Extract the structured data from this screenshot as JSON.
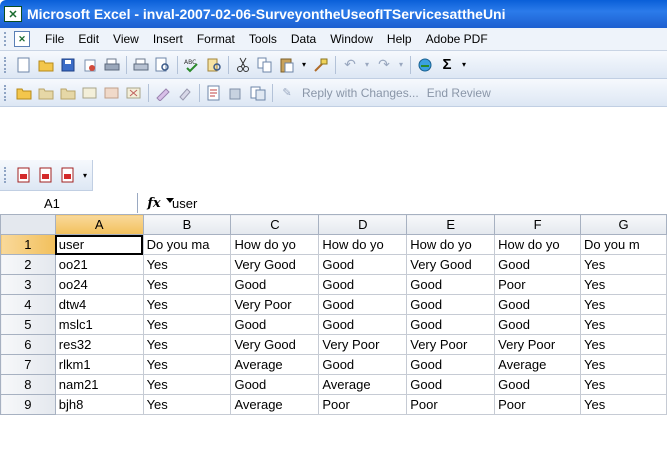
{
  "window": {
    "title": "Microsoft Excel - inval-2007-02-06-SurveyontheUseofITServicesattheUni"
  },
  "menu": [
    "File",
    "Edit",
    "View",
    "Insert",
    "Format",
    "Tools",
    "Data",
    "Window",
    "Help",
    "Adobe PDF"
  ],
  "review_toolbar": {
    "reply_label": "Reply with Changes...",
    "end_review_label": "End Review"
  },
  "formula_bar": {
    "name_box": "A1",
    "fx": "fx",
    "value": "user"
  },
  "columns": [
    "A",
    "B",
    "C",
    "D",
    "E",
    "F",
    "G"
  ],
  "rows": [
    {
      "n": "1",
      "cells": [
        "user",
        "Do you ma",
        "How do yo",
        "How do yo",
        "How do yo",
        "How do yo",
        "Do you m"
      ]
    },
    {
      "n": "2",
      "cells": [
        "oo21",
        "Yes",
        "Very Good",
        "Good",
        "Very Good",
        "Good",
        "Yes"
      ]
    },
    {
      "n": "3",
      "cells": [
        "oo24",
        "Yes",
        "Good",
        "Good",
        "Good",
        "Poor",
        "Yes"
      ]
    },
    {
      "n": "4",
      "cells": [
        "dtw4",
        "Yes",
        "Very Poor",
        "Good",
        "Good",
        "Good",
        "Yes"
      ]
    },
    {
      "n": "5",
      "cells": [
        "mslc1",
        "Yes",
        "Good",
        "Good",
        "Good",
        "Good",
        "Yes"
      ]
    },
    {
      "n": "6",
      "cells": [
        "res32",
        "Yes",
        "Very Good",
        "Very Poor",
        "Very Poor",
        "Very Poor",
        "Yes"
      ]
    },
    {
      "n": "7",
      "cells": [
        "rlkm1",
        "Yes",
        "Average",
        "Good",
        "Good",
        "Average",
        "Yes"
      ]
    },
    {
      "n": "8",
      "cells": [
        "nam21",
        "Yes",
        "Good",
        "Average",
        "Good",
        "Good",
        "Yes"
      ]
    },
    {
      "n": "9",
      "cells": [
        "bjh8",
        "Yes",
        "Average",
        "Poor",
        "Poor",
        "Poor",
        "Yes"
      ]
    }
  ],
  "colors": {
    "title_bar": "#1d5fd0",
    "selected_header": "#f2c05c"
  }
}
